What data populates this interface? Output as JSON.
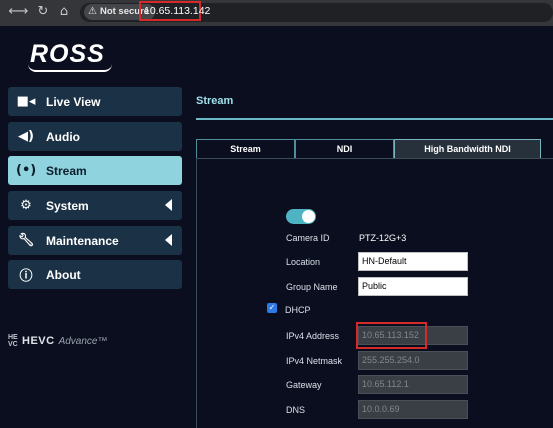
{
  "browser": {
    "back_icon": "arrow-left-icon",
    "forward_icon": "arrow-right-icon",
    "reload_icon": "reload-icon",
    "home_icon": "home-icon",
    "security_label": "Not secure",
    "url": "10.65.113.142"
  },
  "brand": {
    "logo": "ROSS"
  },
  "sidebar": {
    "items": [
      {
        "label": "Live View",
        "icon": "camera-icon"
      },
      {
        "label": "Audio",
        "icon": "speaker-icon"
      },
      {
        "label": "Stream",
        "icon": "broadcast-icon"
      },
      {
        "label": "System",
        "icon": "gear-icon"
      },
      {
        "label": "Maintenance",
        "icon": "wrench-icon"
      },
      {
        "label": "About",
        "icon": "info-icon"
      }
    ],
    "footer": {
      "mark": "HE VC",
      "brand": "HEVC",
      "suffix": "Advance™"
    }
  },
  "main": {
    "title": "Stream",
    "tabs": [
      {
        "label": "Stream"
      },
      {
        "label": "NDI"
      },
      {
        "label": "High Bandwidth NDI"
      }
    ],
    "form": {
      "camera_id_label": "Camera ID",
      "camera_id_value": "PTZ-12G+3",
      "location_label": "Location",
      "location_value": "HN-Default",
      "group_name_label": "Group Name",
      "group_name_value": "Public",
      "dhcp_label": "DHCP",
      "ipv4_address_label": "IPv4 Address",
      "ipv4_address_value": "10.65.113.152",
      "ipv4_netmask_label": "IPv4 Netmask",
      "ipv4_netmask_value": "255.255.254.0",
      "gateway_label": "Gateway",
      "gateway_value": "10.65.112.1",
      "dns_label": "DNS",
      "dns_value": "10.0.0.69"
    }
  },
  "colors": {
    "accent": "#8fd3de",
    "menu_bg": "#1b3246",
    "page_bg": "#0a0e1e",
    "highlight_red": "#d42a2a",
    "toggle_on": "#4eb3c2"
  }
}
